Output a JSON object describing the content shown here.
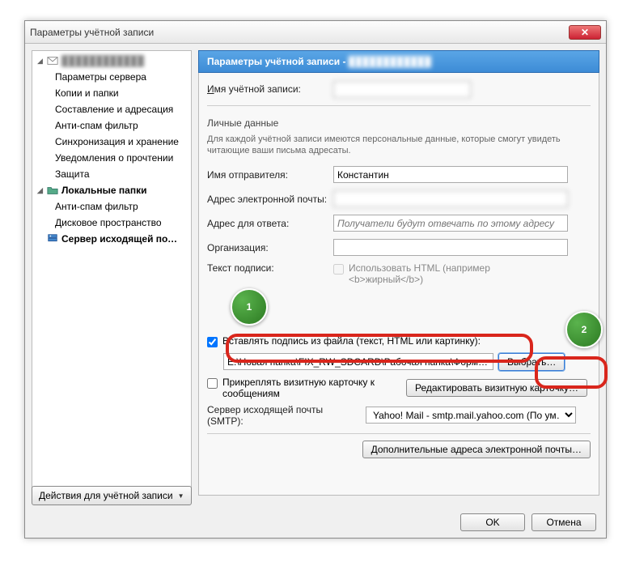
{
  "window": {
    "title": "Параметры учётной записи"
  },
  "sidebar": {
    "account_masked": "████████████",
    "items": [
      "Параметры сервера",
      "Копии и папки",
      "Составление и адресация",
      "Анти-спам фильтр",
      "Синхронизация и хранение",
      "Уведомления о прочтении",
      "Защита"
    ],
    "local_folders": "Локальные папки",
    "local_items": [
      "Анти-спам фильтр",
      "Дисковое пространство"
    ],
    "smtp": "Сервер исходящей почт…"
  },
  "header": {
    "label": "Параметры учётной записи -",
    "value_masked": "████████████"
  },
  "main": {
    "account_name_label": "Имя учётной записи:",
    "account_name_value": "",
    "personal_title": "Личные данные",
    "personal_hint": "Для каждой учётной записи имеются персональные данные, которые смогут увидеть читающие ваши письма адресаты.",
    "sender_label": "Имя отправителя:",
    "sender_value": "Константин",
    "email_label": "Адрес электронной почты:",
    "email_value": "",
    "reply_label": "Адрес для ответа:",
    "reply_placeholder": "Получатели будут отвечать по этому адресу",
    "org_label": "Организация:",
    "org_value": "",
    "sig_label": "Текст подписи:",
    "use_html_label": "Использовать HTML (например <b>жирный</b>)",
    "insert_sig_label": "Вставлять подпись из файла (текст, HTML или картинку):",
    "sig_path": "E:\\Новая папка\\FIX_RW_SDCARD\\Рабочая папка\\Форматы фай",
    "choose_btn": "Выбрать…",
    "vcard_label": "Прикреплять визитную карточку к сообщениям",
    "vcard_btn": "Редактировать визитную карточку…",
    "smtp_label": "Сервер исходящей почты (SMTP):",
    "smtp_value": "Yahoo! Mail - smtp.mail.yahoo.com (По ум…",
    "extra_btn": "Дополнительные адреса электронной почты…"
  },
  "footer": {
    "actions_btn": "Действия для учётной записи",
    "ok": "OK",
    "cancel": "Отмена"
  },
  "badges": {
    "one": "1",
    "two": "2"
  }
}
